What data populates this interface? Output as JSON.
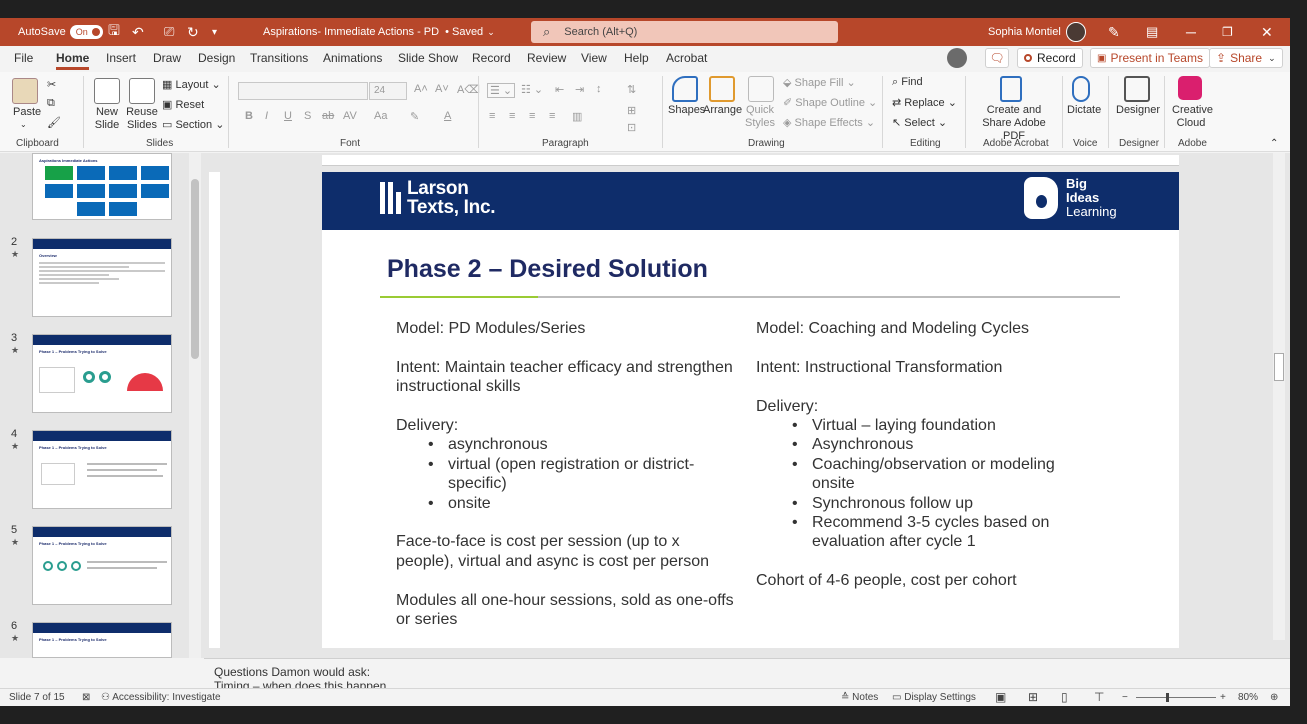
{
  "titlebar": {
    "autosave_label": "AutoSave",
    "autosave_state": "On",
    "doc_title": "Aspirations- Immediate Actions - PD",
    "saved_status": "• Saved",
    "search_placeholder": "Search (Alt+Q)",
    "user_name": "Sophia Montiel"
  },
  "menu": {
    "tabs": [
      "File",
      "Home",
      "Insert",
      "Draw",
      "Design",
      "Transitions",
      "Animations",
      "Slide Show",
      "Record",
      "Review",
      "View",
      "Help",
      "Acrobat"
    ],
    "active": "Home",
    "record_label": "Record",
    "present_label": "Present in Teams",
    "share_label": "Share"
  },
  "ribbon": {
    "clipboard": {
      "paste": "Paste",
      "label": "Clipboard"
    },
    "slides": {
      "new_slide": "New Slide",
      "reuse_slides": "Reuse Slides",
      "layout": "Layout",
      "reset": "Reset",
      "section": "Section",
      "label": "Slides"
    },
    "font": {
      "size": "24",
      "label": "Font",
      "case": "Aa"
    },
    "paragraph": {
      "label": "Paragraph"
    },
    "drawing": {
      "shapes": "Shapes",
      "arrange": "Arrange",
      "quick_styles": "Quick Styles",
      "shape_fill": "Shape Fill",
      "shape_outline": "Shape Outline",
      "shape_effects": "Shape Effects",
      "label": "Drawing"
    },
    "editing": {
      "find": "Find",
      "replace": "Replace",
      "select": "Select",
      "label": "Editing"
    },
    "acrobat": {
      "create_share": "Create and Share Adobe PDF",
      "label": "Adobe Acrobat"
    },
    "voice": {
      "dictate": "Dictate",
      "label": "Voice"
    },
    "designer": {
      "designer": "Designer",
      "label": "Designer"
    },
    "adobe": {
      "creative_cloud": "Creative Cloud",
      "label": "Adobe"
    }
  },
  "thumbnails": [
    {
      "num": "",
      "title": "Aspirations Immediate Actions"
    },
    {
      "num": "2",
      "title": "Overview"
    },
    {
      "num": "3",
      "title": "Phase 1 – Problems Trying to Solve"
    },
    {
      "num": "4",
      "title": "Phase 1 – Problems Trying to Solve"
    },
    {
      "num": "5",
      "title": "Phase 1 – Problems Trying to Solve"
    },
    {
      "num": "6",
      "title": "Phase 1 – Problems Trying to Solve"
    }
  ],
  "slide": {
    "logo_left": "Larson Texts, Inc.",
    "logo_right": [
      "Big",
      "Ideas",
      "Learning"
    ],
    "title": "Phase 2 – Desired Solution",
    "left": {
      "model": "Model: PD Modules/Series",
      "intent": "Intent: Maintain teacher efficacy and strengthen instructional skills",
      "delivery": "Delivery:",
      "items": [
        "asynchronous",
        "virtual (open registration or district-specific)",
        "onsite"
      ],
      "cost": "Face-to-face is cost per session (up to x people), virtual and async is cost per person",
      "modules": "Modules all one-hour sessions, sold as one-offs or series"
    },
    "right": {
      "model": "Model: Coaching and Modeling Cycles",
      "intent": "Intent: Instructional Transformation",
      "delivery": "Delivery:",
      "items": [
        "Virtual – laying foundation",
        "Asynchronous",
        "Coaching/observation or modeling onsite",
        "Synchronous follow up",
        "Recommend 3-5 cycles based on evaluation after cycle 1"
      ],
      "cohort": "Cohort of 4-6 people, cost per cohort"
    }
  },
  "notes": {
    "line1": "Questions Damon would ask:",
    "line2": "Timing – when does this happen"
  },
  "status": {
    "slide": "Slide 7 of 15",
    "accessibility": "Accessibility: Investigate",
    "notes": "Notes",
    "display": "Display Settings",
    "zoom": "80%"
  }
}
